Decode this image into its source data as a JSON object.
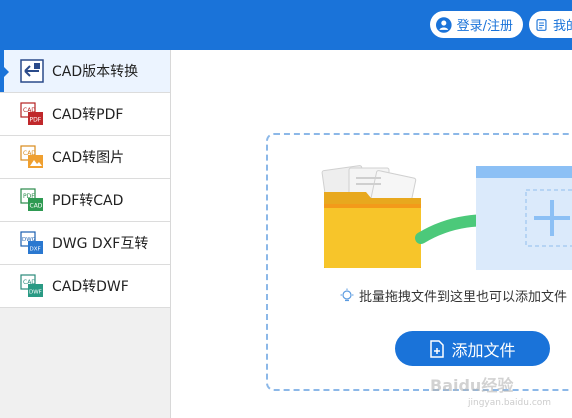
{
  "header": {
    "login_label": "登录/注册",
    "mine_label": "我的"
  },
  "sidebar": {
    "items": [
      {
        "label": "CAD版本转换",
        "icon": "cad-version-icon"
      },
      {
        "label": "CAD转PDF",
        "icon": "cad-to-pdf-icon"
      },
      {
        "label": "CAD转图片",
        "icon": "cad-to-image-icon"
      },
      {
        "label": "PDF转CAD",
        "icon": "pdf-to-cad-icon"
      },
      {
        "label": "DWG DXF互转",
        "icon": "dwg-dxf-icon"
      },
      {
        "label": "CAD转DWF",
        "icon": "cad-to-dwf-icon"
      }
    ],
    "active_index": 0
  },
  "main": {
    "hint_text": "批量拖拽文件到这里也可以添加文件",
    "add_button_label": "添加文件"
  },
  "watermark": {
    "text": "Baidu经验",
    "url": "jingyan.baidu.com"
  },
  "colors": {
    "accent": "#1a73d9",
    "folder": "#f7c52a",
    "arrow": "#4cc97a"
  }
}
